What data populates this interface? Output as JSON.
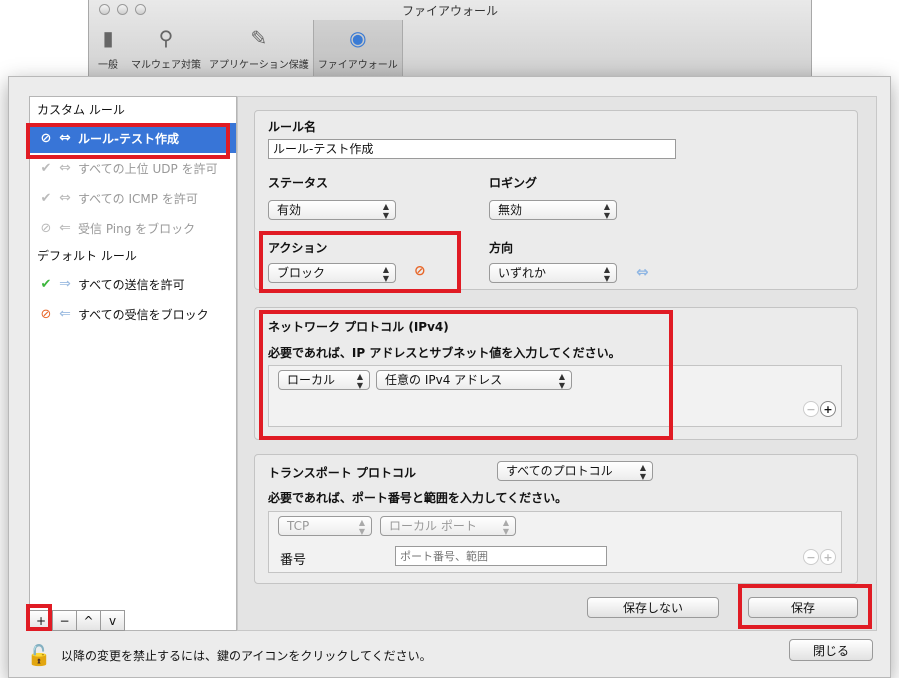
{
  "background_window": {
    "title": "ファイアウォール",
    "toolbar": [
      {
        "label": "一般",
        "icon": "switch-icon"
      },
      {
        "label": "マルウェア対策",
        "icon": "magnifier-icon"
      },
      {
        "label": "アプリケーション保護",
        "icon": "app-pencil-icon"
      },
      {
        "label": "ファイアウォール",
        "icon": "firewall-globe-icon"
      }
    ]
  },
  "sidebar": {
    "custom_header": "カスタム ルール",
    "custom_rules": [
      {
        "label": "ルール-テスト作成",
        "status": "block",
        "direction": "both",
        "selected": true
      },
      {
        "label": "すべての上位 UDP を許可",
        "status": "allow-disabled",
        "direction": "both"
      },
      {
        "label": "すべての ICMP を許可",
        "status": "allow-disabled",
        "direction": "both"
      },
      {
        "label": "受信 Ping をブロック",
        "status": "block-disabled",
        "direction": "in"
      }
    ],
    "default_header": "デフォルト ルール",
    "default_rules": [
      {
        "label": "すべての送信を許可",
        "status": "allow",
        "direction": "out"
      },
      {
        "label": "すべての受信をブロック",
        "status": "block",
        "direction": "in"
      }
    ],
    "buttons": [
      "+",
      "−",
      "^",
      "v"
    ]
  },
  "form": {
    "rule_name_label": "ルール名",
    "rule_name_value": "ルール-テスト作成",
    "status_label": "ステータス",
    "status_value": "有効",
    "logging_label": "ロギング",
    "logging_value": "無効",
    "action_label": "アクション",
    "action_value": "ブロック",
    "direction_label": "方向",
    "direction_value": "いずれか"
  },
  "network": {
    "title": "ネットワーク プロトコル (IPv4)",
    "instruction": "必要であれば、IP アドレスとサブネット値を入力してください。",
    "scope_value": "ローカル",
    "address_value": "任意の IPv4 アドレス"
  },
  "transport": {
    "title": "トランスポート プロトコル",
    "protocol_value": "すべてのプロトコル",
    "instruction": "必要であれば、ポート番号と範囲を入力してください。",
    "proto_value": "TCP",
    "port_scope_value": "ローカル ポート",
    "number_label": "番号",
    "port_placeholder": "ポート番号、範囲"
  },
  "buttons": {
    "dont_save": "保存しない",
    "save": "保存",
    "close": "閉じる"
  },
  "lock_text": "以降の変更を禁止するには、鍵のアイコンをクリックしてください。",
  "colors": {
    "highlight": "#e01b24",
    "selection": "#3875d7",
    "block": "#e8672a",
    "allow": "#3cb63c"
  }
}
